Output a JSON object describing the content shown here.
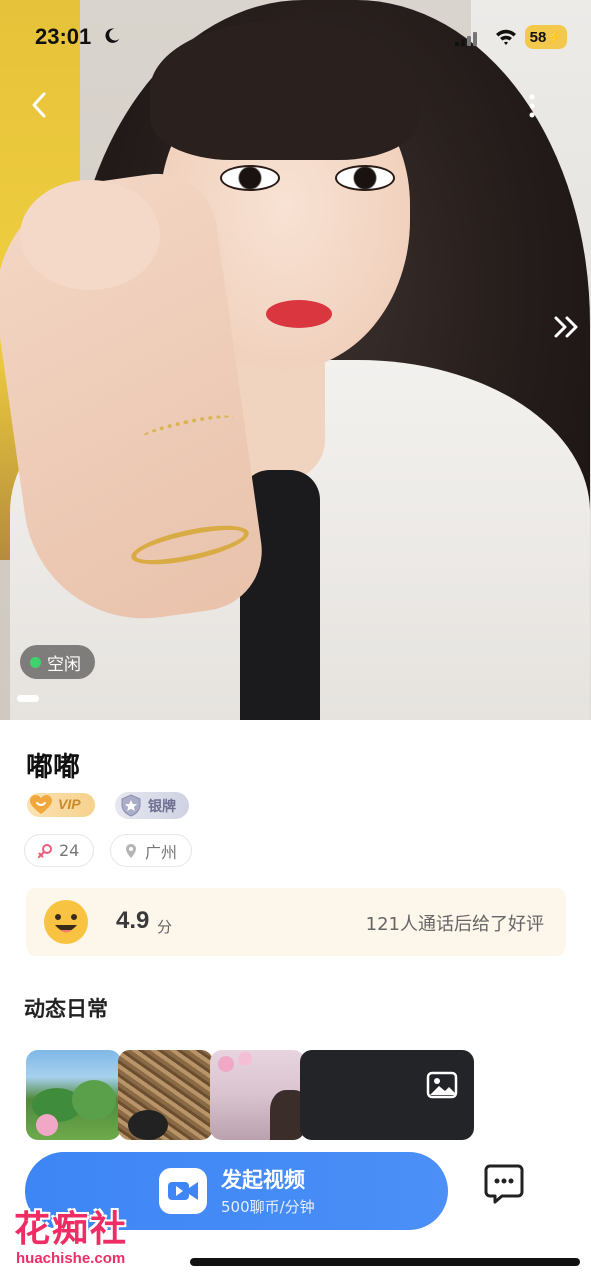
{
  "status_bar": {
    "time": "23:01",
    "battery": "58",
    "icons": [
      "moon-icon",
      "signal-icon",
      "wifi-icon",
      "battery-charging-icon"
    ]
  },
  "hero": {
    "photo": "profile-photo",
    "status_label": "空闲",
    "status_color": "#3fd46b",
    "nav_icons": [
      "back-arrow-icon",
      "more-vertical-icon",
      "double-chevron-right-icon"
    ]
  },
  "profile": {
    "name": "嘟嘟",
    "badges": {
      "vip": "VIP",
      "rank": "银牌"
    },
    "tags": {
      "age": "24",
      "city": "广州"
    }
  },
  "rating": {
    "score": "4.9",
    "unit": "分",
    "review_text": "121人通话后给了好评"
  },
  "moments": {
    "title": "动态日常",
    "thumbnails": [
      "lotus-photo",
      "nest-photo",
      "pink-room-photo"
    ],
    "more_icon": "gallery-icon"
  },
  "actions": {
    "call_title": "发起视频",
    "call_price": "500聊币/分钟",
    "accent": "#3e86f5"
  },
  "watermark": {
    "cn": "花痴社",
    "en": "huachishe.com"
  }
}
